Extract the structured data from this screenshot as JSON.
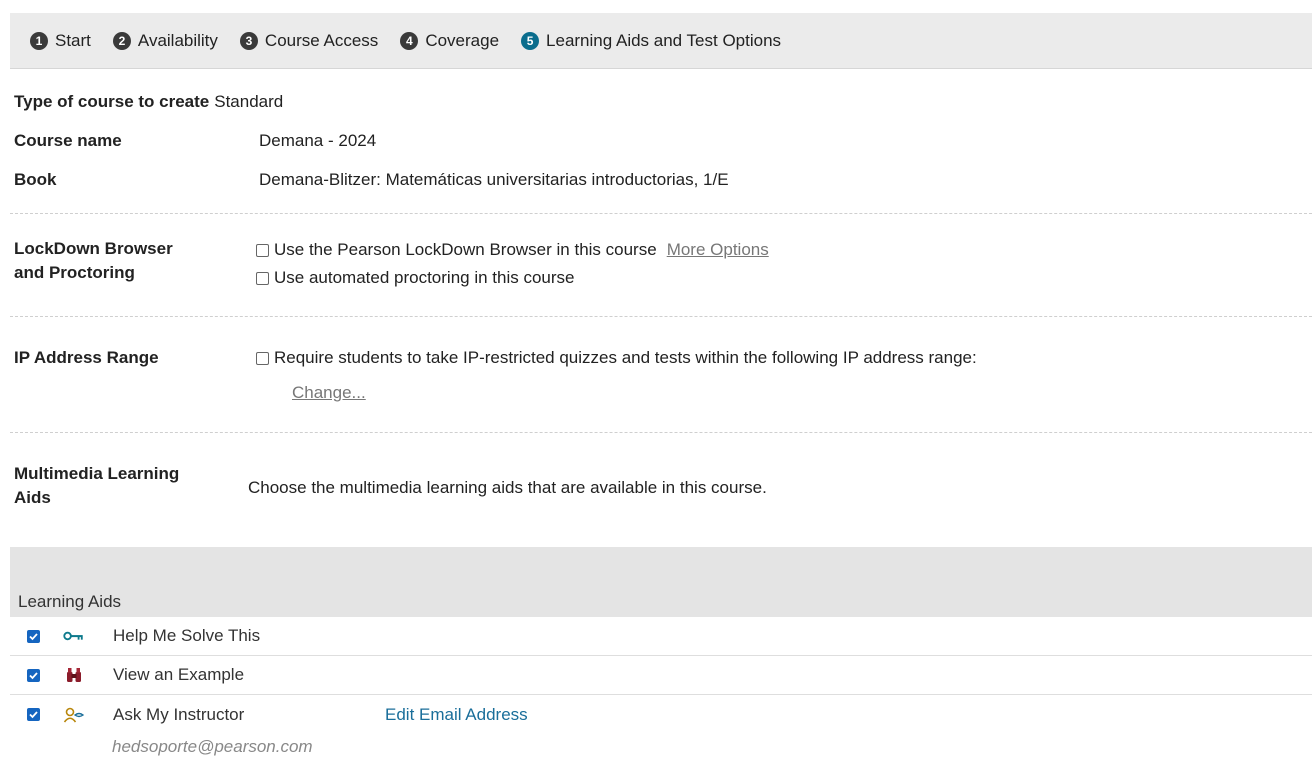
{
  "steps": [
    {
      "num": "1",
      "label": "Start"
    },
    {
      "num": "2",
      "label": "Availability"
    },
    {
      "num": "3",
      "label": "Course Access"
    },
    {
      "num": "4",
      "label": "Coverage"
    },
    {
      "num": "5",
      "label": "Learning Aids and Test Options"
    }
  ],
  "active_step": 5,
  "course": {
    "type_label": "Type of course to create",
    "type_value": "Standard",
    "name_label": "Course name",
    "name_value": "Demana - 2024",
    "book_label": "Book",
    "book_value": "Demana-Blitzer: Matemáticas universitarias introductorias, 1/E"
  },
  "lockdown": {
    "label_line1": "LockDown Browser",
    "label_line2": "and Proctoring",
    "option1": "Use the Pearson LockDown Browser in this course",
    "more_options": "More Options",
    "option2": "Use automated proctoring in this course"
  },
  "ip": {
    "label": "IP Address Range",
    "option": "Require students to take IP-restricted quizzes and tests within the following IP address range:",
    "change": "Change..."
  },
  "multimedia": {
    "label_line1": "Multimedia Learning",
    "label_line2": "Aids",
    "description": "Choose the multimedia learning aids that are available in this course."
  },
  "learning_aids": {
    "header": "Learning Aids",
    "items": [
      {
        "label": "Help Me Solve This",
        "icon": "key-icon",
        "checked": true
      },
      {
        "label": "View an Example",
        "icon": "binoculars-icon",
        "checked": true
      },
      {
        "label": "Ask My Instructor",
        "icon": "instructor-icon",
        "checked": true,
        "link": "Edit Email Address"
      }
    ],
    "email": "hedsoporte@pearson.com"
  },
  "colors": {
    "active_step": "#0a6d8d",
    "link": "#1a6e9a",
    "checkbox": "#1565c0"
  }
}
